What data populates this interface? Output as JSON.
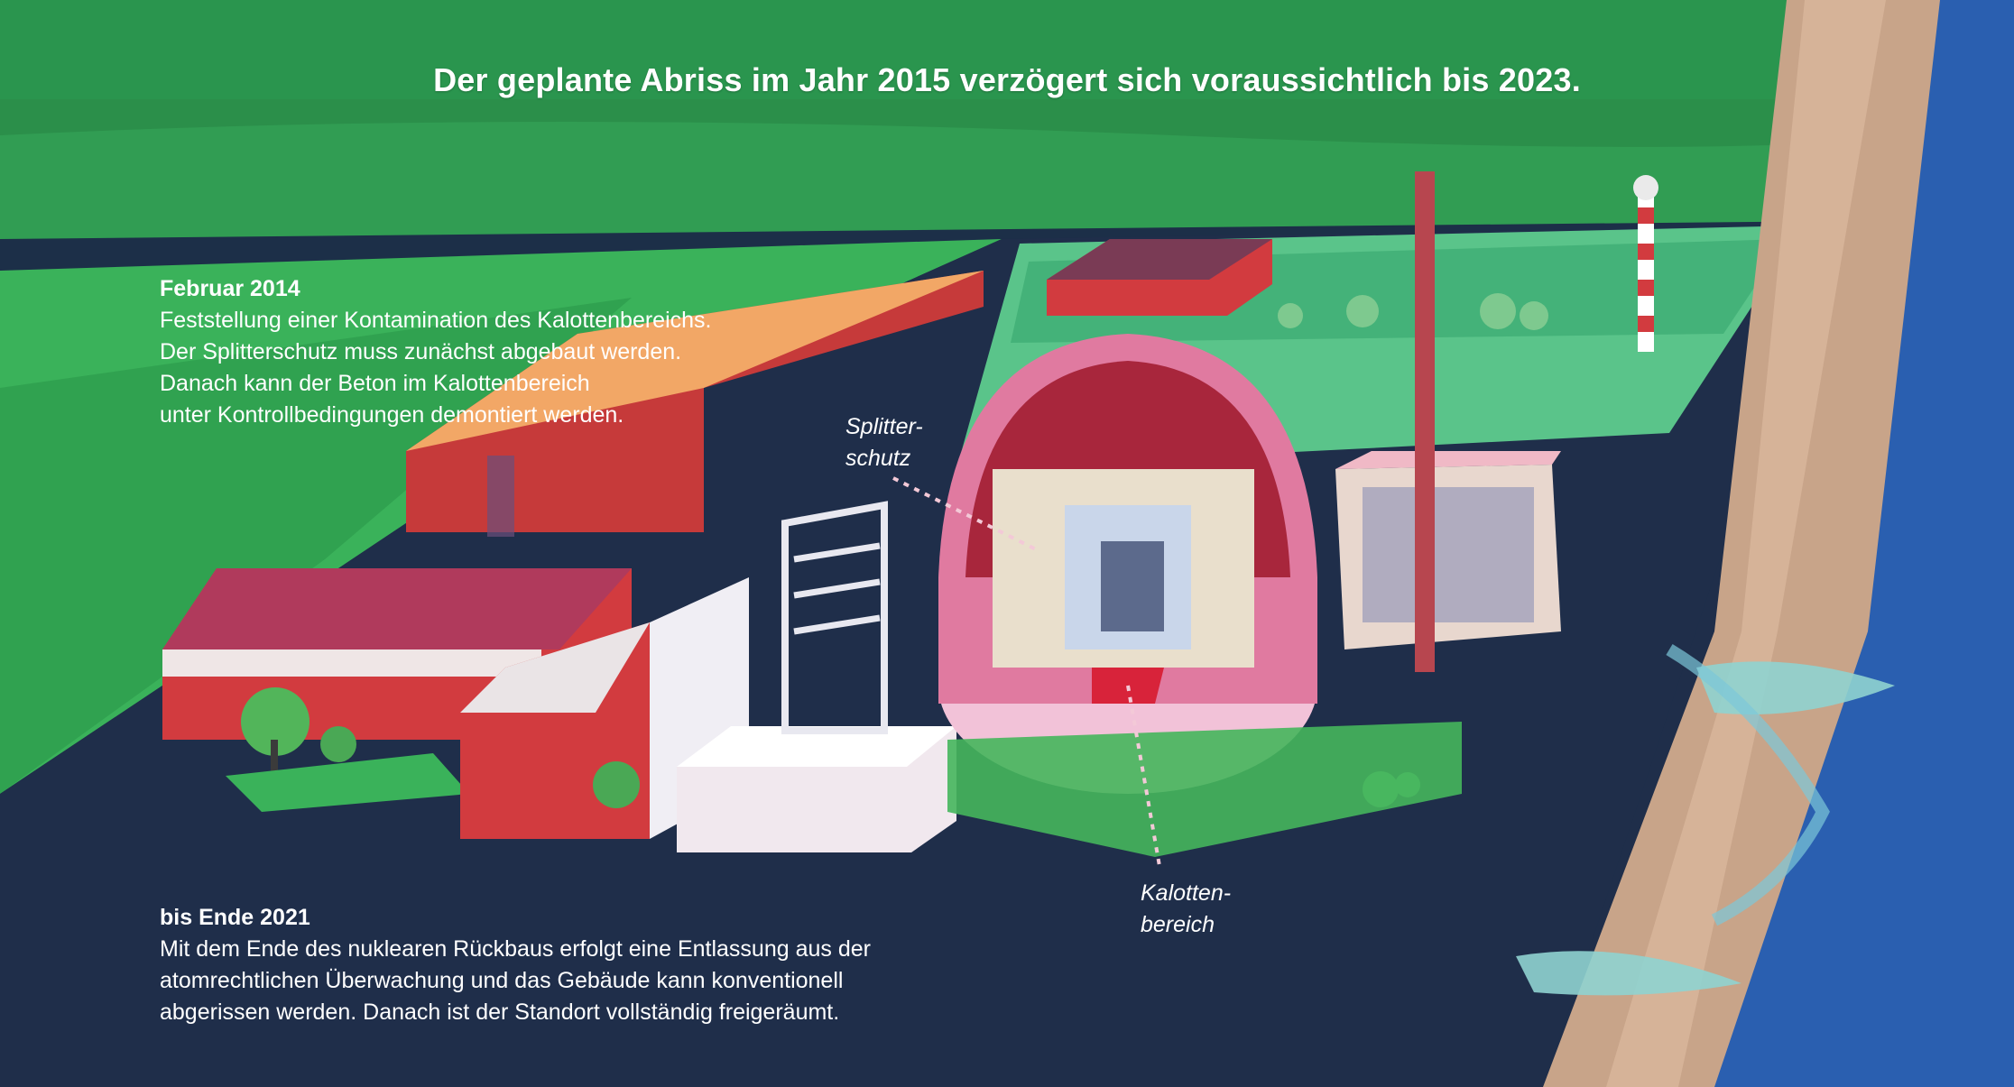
{
  "headline": "Der geplante Abriss im Jahr 2015 verzögert sich voraussichtlich bis 2023.",
  "entries": [
    {
      "date": "Februar 2014",
      "lines": [
        "Feststellung einer Kontamination des Kalottenbereichs.",
        "Der Splitterschutz muss zunächst abgebaut werden.",
        "Danach kann der Beton im Kalottenbereich",
        "unter Kontrollbedingungen demontiert werden."
      ]
    },
    {
      "date": "bis Ende 2021",
      "lines": [
        "Mit dem Ende des nuklearen Rückbaus erfolgt eine Entlassung aus der",
        "atomrechtlichen Überwachung und das Gebäude kann konventionell",
        "abgerissen werden. Danach ist der Standort vollständig freigeräumt."
      ]
    }
  ],
  "callouts": {
    "splitterschutz": [
      "Splitter-",
      "schutz"
    ],
    "kalottenbereich": [
      "Kalotten-",
      "bereich"
    ]
  },
  "colors": {
    "field_green": "#2f9a4a",
    "meadow_green": "#45b65c",
    "ground_navy": "#1f2e4a",
    "river_blue": "#2a5fb0",
    "brick_red": "#c8323c",
    "dome_pink": "#e07aa0"
  }
}
